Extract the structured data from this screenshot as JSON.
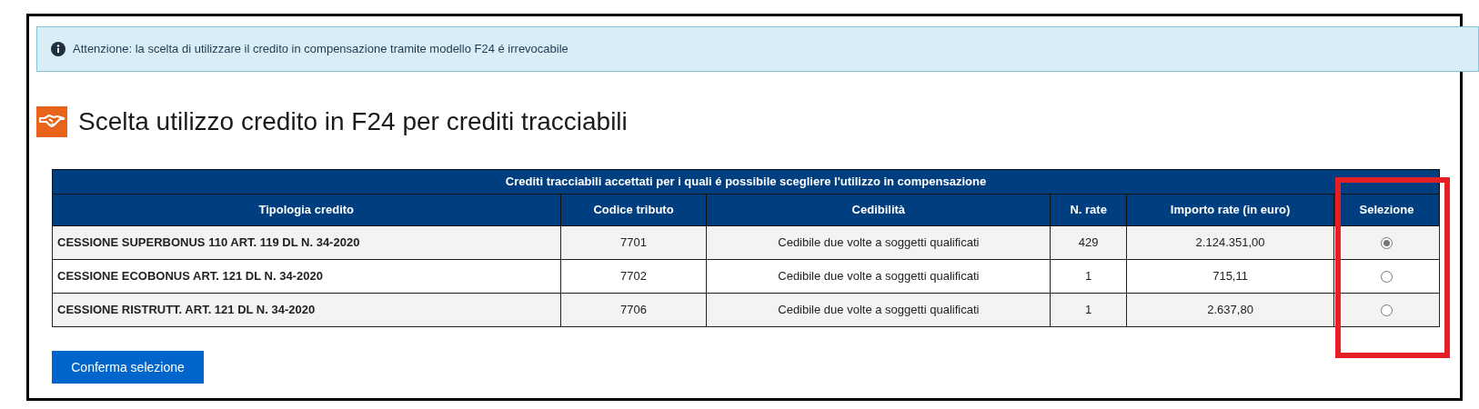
{
  "alert": {
    "text": "Attenzione: la scelta di utilizzare il credito in compensazione tramite modello F24 é irrevocabile"
  },
  "title": "Scelta utilizzo credito in F24 per crediti tracciabili",
  "table": {
    "caption": "Crediti tracciabili accettati per i quali é possibile scegliere l'utilizzo in compensazione",
    "columns": [
      "Tipologia credito",
      "Codice tributo",
      "Cedibilità",
      "N. rate",
      "Importo rate (in euro)",
      "Selezione"
    ],
    "rows": [
      {
        "tipologia": "CESSIONE SUPERBONUS 110 ART. 119 DL N. 34-2020",
        "codice": "7701",
        "cedibilita": "Cedibile due volte a soggetti qualificati",
        "n_rate": "429",
        "importo": "2.124.351,00",
        "selected": true
      },
      {
        "tipologia": "CESSIONE ECOBONUS ART. 121 DL N. 34-2020",
        "codice": "7702",
        "cedibilita": "Cedibile due volte a soggetti qualificati",
        "n_rate": "1",
        "importo": "715,11",
        "selected": false
      },
      {
        "tipologia": "CESSIONE RISTRUTT. ART. 121 DL N. 34-2020",
        "codice": "7706",
        "cedibilita": "Cedibile due volte a soggetti qualificati",
        "n_rate": "1",
        "importo": "2.637,80",
        "selected": false
      }
    ]
  },
  "button": "Conferma selezione"
}
